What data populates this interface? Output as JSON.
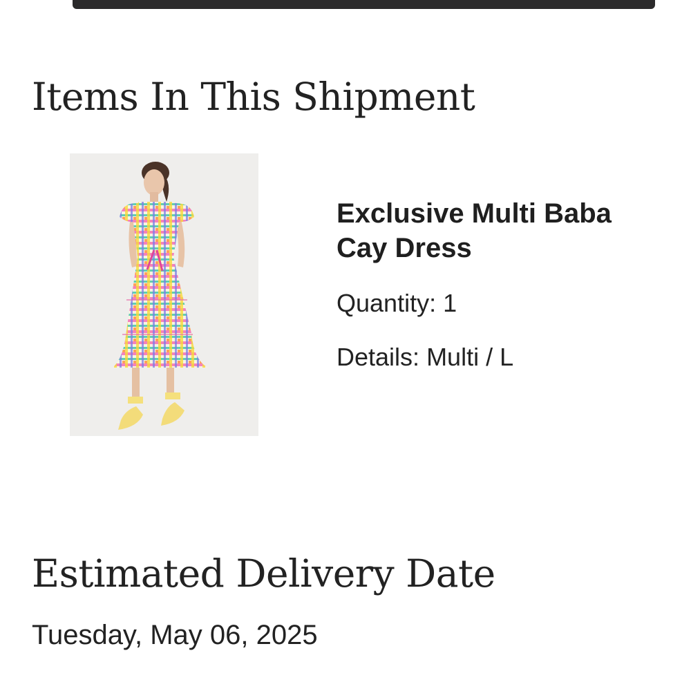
{
  "shipment": {
    "heading": "Items In This Shipment",
    "items": [
      {
        "name": "Exclusive Multi Baba Cay Dress",
        "quantity_label": "Quantity:",
        "quantity": "1",
        "details_label": "Details:",
        "details": "Multi / L"
      }
    ]
  },
  "delivery": {
    "heading": "Estimated Delivery Date",
    "date": "Tuesday, May 06, 2025"
  },
  "colors": {
    "header_bar": "#2b2a2b",
    "text": "#222222",
    "image_background": "#efeeec"
  }
}
